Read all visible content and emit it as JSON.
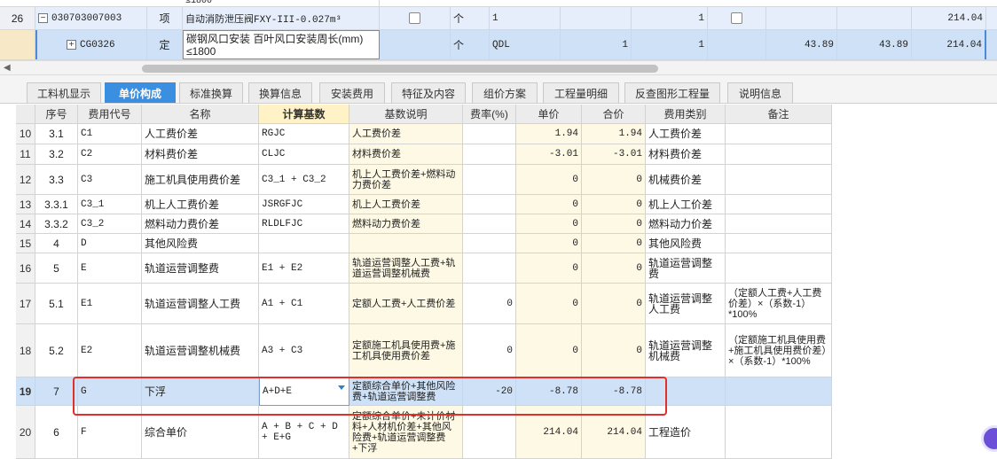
{
  "top_rows": [
    {
      "row_no": "26",
      "toggle": "−",
      "code": "030703007003",
      "type": "项",
      "name": "自动消防泄压阀FXY-III-0.027m³",
      "unit": "个",
      "qty_expr": "1",
      "qty": "1",
      "total": "214.04"
    },
    {
      "row_no": "",
      "toggle": "+",
      "code": "CG0326",
      "type": "定",
      "name_line1": "碳钢风口安装 百叶风口安装周长(mm)",
      "name_line2": "≤1800",
      "unit": "个",
      "qty_expr": "QDL",
      "factor": "1",
      "qty": "1",
      "price": "43.89",
      "amount": "43.89",
      "total": "214.04"
    }
  ],
  "top_cut_text": "≤1800",
  "tabs": [
    "工料机显示",
    "单价构成",
    "标准换算",
    "换算信息",
    "安装费用",
    "特征及内容",
    "组价方案",
    "工程量明细",
    "反查图形工程量",
    "说明信息"
  ],
  "active_tab": "单价构成",
  "columns": [
    "",
    "序号",
    "费用代号",
    "名称",
    "计算基数",
    "基数说明",
    "费率(%)",
    "单价",
    "合价",
    "费用类别",
    "备注"
  ],
  "rows": [
    {
      "n": "10",
      "seq": "3.1",
      "code": "C1",
      "name": "人工费价差",
      "base": "RGJC",
      "desc": "人工费价差",
      "rate": "",
      "price": "1.94",
      "amount": "1.94",
      "cat": "人工费价差",
      "note": ""
    },
    {
      "n": "11",
      "seq": "3.2",
      "code": "C2",
      "name": "材料费价差",
      "base": "CLJC",
      "desc": "材料费价差",
      "rate": "",
      "price": "-3.01",
      "amount": "-3.01",
      "cat": "材料费价差",
      "note": ""
    },
    {
      "n": "12",
      "seq": "3.3",
      "code": "C3",
      "name": "施工机具使用费价差",
      "base": "C3_1 + C3_2",
      "desc": "机上人工费价差+燃料动力费价差",
      "rate": "",
      "price": "0",
      "amount": "0",
      "cat": "机械费价差",
      "note": ""
    },
    {
      "n": "13",
      "seq": "3.3.1",
      "code": "C3_1",
      "name": "机上人工费价差",
      "base": "JSRGFJC",
      "desc": "机上人工费价差",
      "rate": "",
      "price": "0",
      "amount": "0",
      "cat": "机上人工价差",
      "note": ""
    },
    {
      "n": "14",
      "seq": "3.3.2",
      "code": "C3_2",
      "name": "燃料动力费价差",
      "base": "RLDLFJC",
      "desc": "燃料动力费价差",
      "rate": "",
      "price": "0",
      "amount": "0",
      "cat": "燃料动力价差",
      "note": ""
    },
    {
      "n": "15",
      "seq": "4",
      "code": "D",
      "name": "其他风险费",
      "base": "",
      "desc": "",
      "rate": "",
      "price": "0",
      "amount": "0",
      "cat": "其他风险费",
      "note": ""
    },
    {
      "n": "16",
      "seq": "5",
      "code": "E",
      "name": "轨道运营调整费",
      "base": "E1 + E2",
      "desc": "轨道运营调整人工费+轨道运营调整机械费",
      "rate": "",
      "price": "0",
      "amount": "0",
      "cat": "轨道运营调整费",
      "note": ""
    },
    {
      "n": "17",
      "seq": "5.1",
      "code": "E1",
      "name": "轨道运营调整人工费",
      "base": "A1 + C1",
      "desc": "定额人工费+人工费价差",
      "rate": "0",
      "price": "0",
      "amount": "0",
      "cat": "轨道运营调整人工费",
      "note": "（定额人工费+人工费价差）×（系数-1）*100%"
    },
    {
      "n": "18",
      "seq": "5.2",
      "code": "E2",
      "name": "轨道运营调整机械费",
      "base": "A3 + C3",
      "desc": "定额施工机具使用费+施工机具使用费价差",
      "rate": "0",
      "price": "0",
      "amount": "0",
      "cat": "轨道运营调整机械费",
      "note": "（定额施工机具使用费+施工机具使用费价差）×（系数-1）*100%"
    },
    {
      "n": "19",
      "seq": "7",
      "code": "G",
      "name": "下浮",
      "base": "A+D+E",
      "desc": "定额综合单价+其他风险费+轨道运营调整费",
      "rate": "-20",
      "price": "-8.78",
      "amount": "-8.78",
      "cat": "",
      "note": ""
    },
    {
      "n": "20",
      "seq": "6",
      "code": "F",
      "name": "综合单价",
      "base": "A + B + C + D + E+G",
      "desc": "定额综合单价+未计价材料+人材机价差+其他风险费+轨道运营调整费+下浮",
      "rate": "",
      "price": "214.04",
      "amount": "214.04",
      "cat": "工程造价",
      "note": ""
    }
  ],
  "colors": {
    "selected_row": "#cfe1f6",
    "active_tab": "#3b8fe0",
    "highlight_box": "#e0302c",
    "header_highlight": "#fff2c6"
  }
}
